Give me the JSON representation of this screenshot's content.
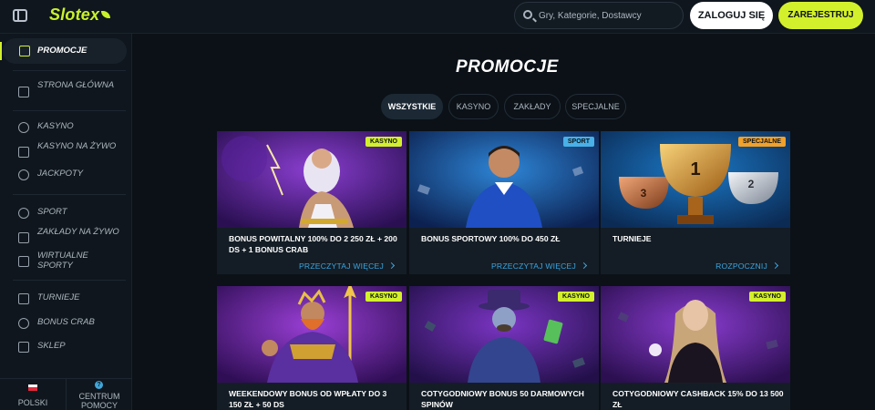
{
  "header": {
    "logo": "Slotex",
    "search_placeholder": "Gry, Kategorie, Dostawcy",
    "login_label": "ZALOGUJ SIĘ",
    "register_label": "ZAREJESTRUJ"
  },
  "sidebar": {
    "items": [
      {
        "label": "PROMOCJE",
        "icon": "promotions-icon"
      },
      {
        "label": "STRONA GŁÓWNA",
        "icon": "home-icon"
      },
      {
        "label": "KASYNO",
        "icon": "casino-chip-icon"
      },
      {
        "label": "KASYNO NA ŻYWO",
        "icon": "live-casino-icon"
      },
      {
        "label": "JACKPOTY",
        "icon": "jackpot-icon"
      },
      {
        "label": "SPORT",
        "icon": "football-icon"
      },
      {
        "label": "ZAKŁADY NA ŻYWO",
        "icon": "live-bets-icon"
      },
      {
        "label": "WIRTUALNE SPORTY",
        "icon": "virtual-sports-icon"
      },
      {
        "label": "TURNIEJE",
        "icon": "trophy-icon"
      },
      {
        "label": "BONUS CRAB",
        "icon": "crab-icon"
      },
      {
        "label": "SKLEP",
        "icon": "shop-icon"
      }
    ],
    "footer": {
      "language_label": "POLSKI",
      "help_label": "CENTRUM POMOCY"
    }
  },
  "main": {
    "title": "PROMOCJE",
    "tabs": [
      {
        "label": "WSZYSTKIE",
        "active": true
      },
      {
        "label": "KASYNO",
        "active": false
      },
      {
        "label": "ZAKŁADY",
        "active": false
      },
      {
        "label": "SPECJALNE",
        "active": false
      }
    ],
    "cards": [
      {
        "badge": "KASYNO",
        "badge_type": "casino",
        "title": "BONUS POWITALNY 100% DO 2 250 ZŁ + 200 DS + 1 BONUS CRAB",
        "link": "PRZECZYTAJ WIĘCEJ"
      },
      {
        "badge": "SPORT",
        "badge_type": "sport",
        "title": "BONUS SPORTOWY 100% DO 450 ZŁ",
        "link": "PRZECZYTAJ WIĘCEJ"
      },
      {
        "badge": "SPECJALNE",
        "badge_type": "special",
        "title": "TURNIEJE",
        "link": "ROZPOCZNIJ"
      },
      {
        "badge": "KASYNO",
        "badge_type": "casino",
        "title": "WEEKENDOWY BONUS OD WPŁATY DO 3 150 ZŁ + 50 DS",
        "link": ""
      },
      {
        "badge": "KASYNO",
        "badge_type": "casino",
        "title": "COTYGODNIOWY BONUS 50 DARMOWYCH SPINÓW",
        "link": ""
      },
      {
        "badge": "KASYNO",
        "badge_type": "casino",
        "title": "COTYGODNIOWY CASHBACK 15% DO 13 500 ZŁ",
        "link": ""
      }
    ]
  },
  "colors": {
    "accent": "#d3f02c",
    "link": "#3ca5e0",
    "sport_badge": "#49b1e7",
    "special_badge": "#f2a12a",
    "background": "#0b1117"
  }
}
